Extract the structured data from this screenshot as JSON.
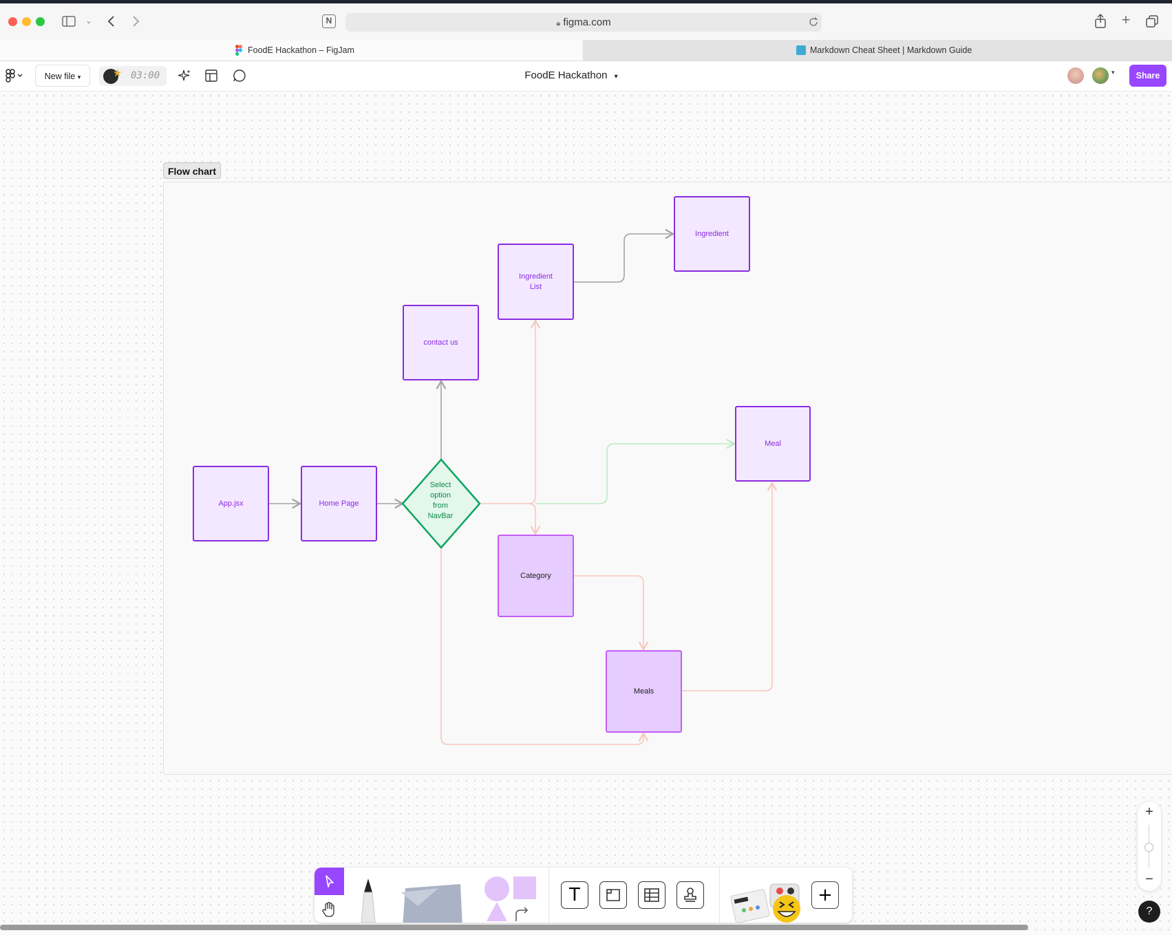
{
  "browser": {
    "url": "figma.com",
    "tabs": [
      {
        "label": "FoodE Hackathon – FigJam",
        "active": true
      },
      {
        "label": "Markdown Cheat Sheet | Markdown Guide",
        "active": false
      }
    ]
  },
  "figjam": {
    "new_file_label": "New file",
    "timer": "03:00",
    "file_title": "FoodE Hackathon",
    "share_label": "Share"
  },
  "canvas": {
    "section_label": "Flow chart",
    "nodes": {
      "app": "App.jsx",
      "home": "Home Page",
      "decision": "Select\noption\nfrom\nNavBar",
      "contact": "contact us",
      "ingredient_list": "Ingredient\nList",
      "ingredient": "Ingredient",
      "meal": "Meal",
      "category": "Category",
      "meals": "Meals"
    }
  },
  "colors": {
    "accent": "#9747ff",
    "node_border": "#8a2be2",
    "node_fill": "#f3e8ff",
    "decision_border": "#0ea560",
    "decision_fill": "#e3f7ea"
  },
  "icons": [
    "lock-icon",
    "reload-icon",
    "share-icon",
    "new-tab-icon",
    "tab-overview-icon",
    "sidebar-icon",
    "back-icon",
    "forward-icon",
    "figma-menu-icon",
    "ai-sparkle-icon",
    "template-icon",
    "comment-icon",
    "cursor-icon",
    "hand-icon",
    "marker-icon",
    "sticky-note-icon",
    "shapes-icon",
    "connector-icon",
    "text-icon",
    "section-icon",
    "table-icon",
    "stamp-icon",
    "widgets-icon",
    "plus-icon",
    "zoom-in-icon",
    "zoom-out-icon",
    "help-icon"
  ]
}
